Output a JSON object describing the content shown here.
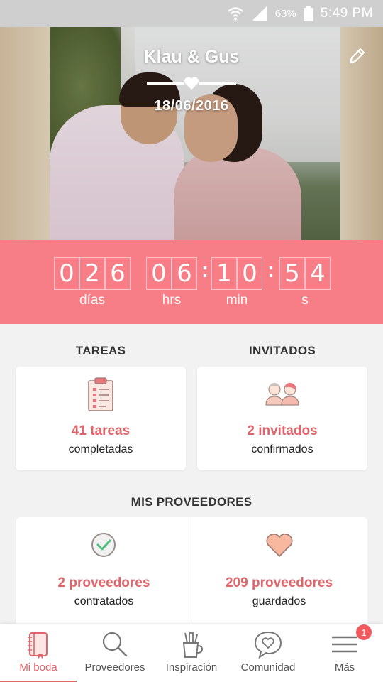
{
  "status_bar": {
    "battery_pct": "63%",
    "time": "5:49 PM"
  },
  "header": {
    "names": "Klau & Gus",
    "date": "18/06/2016",
    "edit_icon": "pencil-icon"
  },
  "countdown": {
    "days": [
      "0",
      "2",
      "6"
    ],
    "hours": [
      "0",
      "6"
    ],
    "minutes": [
      "1",
      "0"
    ],
    "seconds": [
      "5",
      "4"
    ],
    "labels": {
      "days": "días",
      "hours": "hrs",
      "minutes": "min",
      "seconds": "s"
    }
  },
  "tareas": {
    "title": "TAREAS",
    "count": "41 tareas",
    "sub": "completadas",
    "icon": "clipboard-icon"
  },
  "invitados": {
    "title": "INVITADOS",
    "count": "2 invitados",
    "sub": "confirmados",
    "icon": "guests-icon"
  },
  "proveedores": {
    "title": "MIS PROVEEDORES",
    "contratados": {
      "count": "2 proveedores",
      "sub": "contratados",
      "icon": "check-circle-icon"
    },
    "guardados": {
      "count": "209 proveedores",
      "sub": "guardados",
      "icon": "heart-icon"
    }
  },
  "bottom_nav": {
    "items": [
      {
        "label": "Mi boda",
        "icon": "notebook-icon",
        "active": true
      },
      {
        "label": "Proveedores",
        "icon": "search-icon"
      },
      {
        "label": "Inspiración",
        "icon": "pencil-cup-icon"
      },
      {
        "label": "Comunidad",
        "icon": "chat-heart-icon"
      },
      {
        "label": "Más",
        "icon": "menu-icon",
        "badge": "1"
      }
    ]
  },
  "colors": {
    "accent": "#e1646b",
    "countdown_bg": "#f77d86"
  }
}
